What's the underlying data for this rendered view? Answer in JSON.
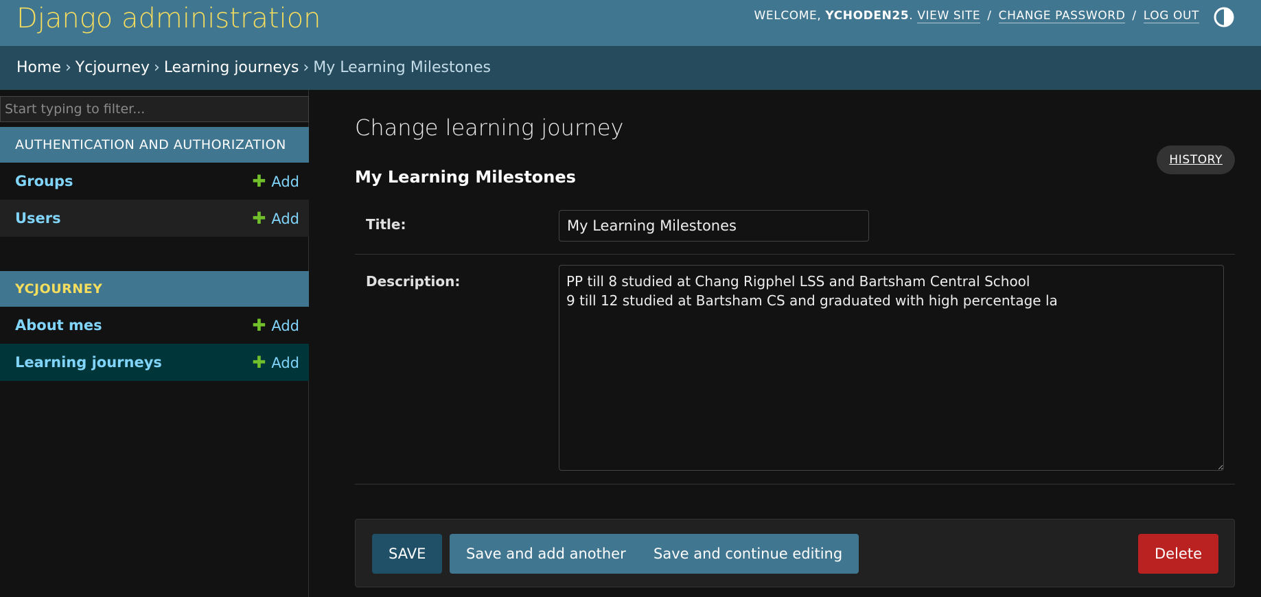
{
  "header": {
    "branding": "Django administration",
    "welcome": "WELCOME,",
    "username": "YCHODEN25",
    "view_site": "VIEW SITE",
    "change_password": "CHANGE PASSWORD",
    "log_out": "LOG OUT",
    "separator": "/",
    "theme_icon": "contrast-toggle-icon"
  },
  "breadcrumbs": {
    "items": [
      "Home",
      "Ycjourney",
      "Learning journeys"
    ],
    "separator": "›",
    "current": "My Learning Milestones"
  },
  "sidebar": {
    "filter_placeholder": "Start typing to filter...",
    "modules": [
      {
        "caption": "AUTHENTICATION AND AUTHORIZATION",
        "models": [
          {
            "name": "Groups",
            "add_label": "Add"
          },
          {
            "name": "Users",
            "add_label": "Add"
          }
        ]
      },
      {
        "caption": "YCJOURNEY",
        "models": [
          {
            "name": "About mes",
            "add_label": "Add"
          },
          {
            "name": "Learning journeys",
            "add_label": "Add",
            "selected": true
          }
        ]
      }
    ]
  },
  "main": {
    "page_title": "Change learning journey",
    "history_label": "HISTORY",
    "object_name": "My Learning Milestones",
    "fields": {
      "title": {
        "label": "Title:",
        "value": "My Learning Milestones"
      },
      "description": {
        "label": "Description:",
        "value": "PP till 8 studied at Chang Rigphel LSS and Bartsham Central School\n9 till 12 studied at Bartsham CS and graduated with high percentage la"
      }
    },
    "buttons": {
      "save": "SAVE",
      "save_add_another": "Save and add another",
      "save_continue": "Save and continue editing",
      "delete": "Delete"
    }
  },
  "colors": {
    "header_bg": "#417690",
    "brand_yellow": "#f5dd5d",
    "breadcrumb_bg": "#264b5d",
    "link_blue": "#81d4fa",
    "add_green": "#70bf2b",
    "delete_red": "#ba2121"
  }
}
